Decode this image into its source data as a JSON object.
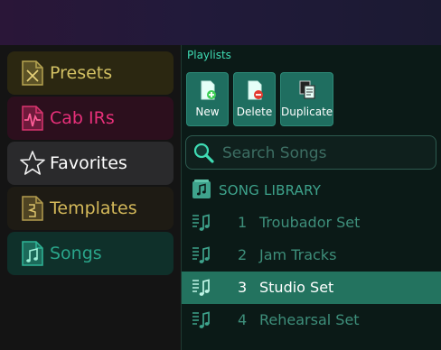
{
  "sidebar": {
    "items": [
      {
        "label": "Presets",
        "icon": "presets-file-icon"
      },
      {
        "label": "Cab IRs",
        "icon": "cab-ir-waveform-icon"
      },
      {
        "label": "Favorites",
        "icon": "star-icon"
      },
      {
        "label": "Templates",
        "icon": "templates-file-icon"
      },
      {
        "label": "Songs",
        "icon": "songs-file-icon"
      }
    ],
    "selected": "Songs"
  },
  "panel": {
    "title": "Playlists",
    "buttons": [
      {
        "label": "New",
        "icon": "new-playlist-icon"
      },
      {
        "label": "Delete",
        "icon": "delete-playlist-icon"
      },
      {
        "label": "Duplicate",
        "icon": "duplicate-playlist-icon"
      }
    ],
    "search": {
      "placeholder": "Search Songs",
      "value": ""
    },
    "library_label": "SONG LIBRARY",
    "playlists": [
      {
        "num": "1",
        "name": "Troubador Set"
      },
      {
        "num": "2",
        "name": "Jam Tracks"
      },
      {
        "num": "3",
        "name": "Studio Set"
      },
      {
        "num": "4",
        "name": "Rehearsal Set"
      }
    ],
    "selected_playlist": "Studio Set"
  },
  "colors": {
    "presets": "#d2c063",
    "cab_irs": "#e8307a",
    "favorites": "#ffffff",
    "templates": "#d4b95a",
    "songs": "#2aa58a",
    "accent": "#3fdcb4",
    "selected_row": "#23735f"
  }
}
